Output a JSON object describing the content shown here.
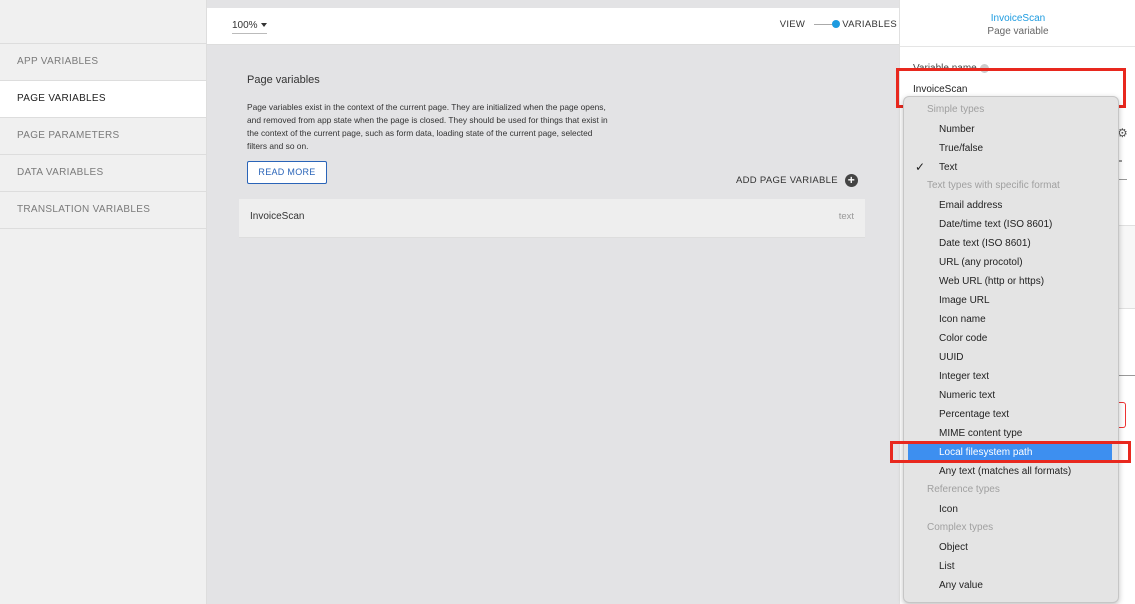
{
  "sidebar": {
    "items": [
      {
        "label": "APP VARIABLES"
      },
      {
        "label": "PAGE VARIABLES"
      },
      {
        "label": "PAGE PARAMETERS"
      },
      {
        "label": "DATA VARIABLES"
      },
      {
        "label": "TRANSLATION VARIABLES"
      }
    ],
    "active": "PAGE VARIABLES"
  },
  "toolbar": {
    "zoom": "100%",
    "view_label": "VIEW",
    "variables_label": "VARIABLES"
  },
  "panel": {
    "title": "Page variables",
    "description": "Page variables exist in the context of the current page. They are initialized when the page opens, and removed from app state when the page is closed. They should be used for things that exist in the context of the current page, such as form data, loading state of the current page, selected filters and so on.",
    "read_more": "READ MORE",
    "add_variable": "ADD PAGE VARIABLE",
    "variables": [
      {
        "name": "InvoiceScan",
        "type": "text"
      }
    ]
  },
  "properties": {
    "title": "InvoiceScan",
    "subtitle": "Page variable",
    "variable_name_label": "Variable name",
    "variable_name_value": "InvoiceScan"
  },
  "type_dropdown": {
    "groups": [
      {
        "header": "Simple types",
        "items": [
          "Number",
          "True/false",
          "Text"
        ]
      },
      {
        "header": "Text types with specific format",
        "items": [
          "Email address",
          "Date/time text (ISO 8601)",
          "Date text (ISO 8601)",
          "URL (any procotol)",
          "Web URL (http or https)",
          "Image URL",
          "Icon name",
          "Color code",
          "UUID",
          "Integer text",
          "Numeric text",
          "Percentage text",
          "MIME content type",
          "Local filesystem path",
          "Any text (matches all formats)"
        ]
      },
      {
        "header": "Reference types",
        "items": [
          "Icon"
        ]
      },
      {
        "header": "Complex types",
        "items": [
          "Object",
          "List",
          "Any value"
        ]
      }
    ],
    "checked": "Text",
    "highlighted": "Local filesystem path"
  },
  "colors": {
    "accent": "#1d9be0",
    "link": "#2a64b8",
    "selection": "#3d8ff0",
    "annotation_red": "#e8281e"
  }
}
